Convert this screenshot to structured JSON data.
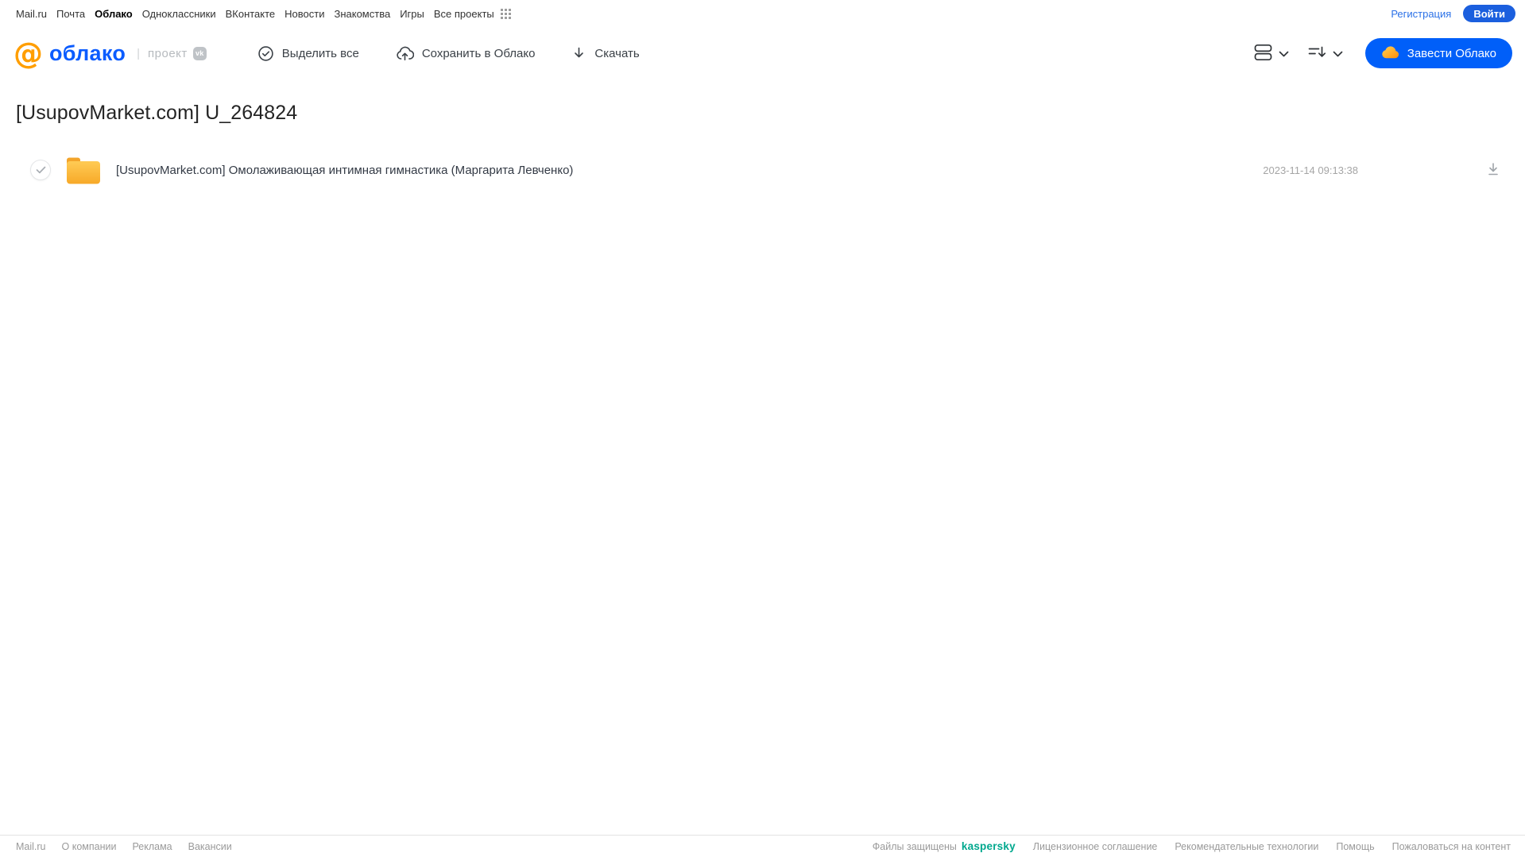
{
  "portal_bar": {
    "links": [
      "Mail.ru",
      "Почта",
      "Облако",
      "Одноклассники",
      "ВКонтакте",
      "Новости",
      "Знакомства",
      "Игры",
      "Все проекты"
    ],
    "active_link": "Облако",
    "register_label": "Регистрация",
    "login_label": "Войти"
  },
  "header": {
    "logo": {
      "at_symbol": "@",
      "text": "облако",
      "divider": "|",
      "project_label": "проект",
      "vk_badge": "vk"
    },
    "toolbar": {
      "select_all_label": "Выделить все",
      "save_label": "Сохранить в Облако",
      "download_label": "Скачать"
    },
    "create_cloud_label": "Завести Облако",
    "icons": {
      "select_all": "check-circle",
      "save": "cloud-upload",
      "download": "arrow-down",
      "view_mode": "list-view",
      "sort": "sort-descending",
      "chevron": "chevron-down",
      "create_cloud": "orange-cloud"
    }
  },
  "main": {
    "title": "[UsupovMarket.com] U_264824",
    "files": [
      {
        "type": "folder",
        "icon": "folder-icon",
        "name": "[UsupovMarket.com] Омолаживающая интимная гимнастика (Маргарита Левченко)",
        "date": "2023-11-14 09:13:38",
        "action_icon": "download-arrow"
      }
    ]
  },
  "footer": {
    "left_links": [
      "Mail.ru",
      "О компании",
      "Реклама",
      "Вакансии"
    ],
    "protected_label": "Файлы защищены",
    "kaspersky_label": "kaspersky",
    "right_links": [
      "Лицензионное соглашение",
      "Рекомендательные технологии",
      "Помощь",
      "Пожаловаться на контент"
    ]
  },
  "colors": {
    "accent_blue": "#005FF9",
    "logo_orange": "#FF9E00",
    "kaspersky_green": "#00A88E",
    "folder_yellow": "#F9B233",
    "text_dark": "#333333",
    "text_gray": "#999999"
  }
}
